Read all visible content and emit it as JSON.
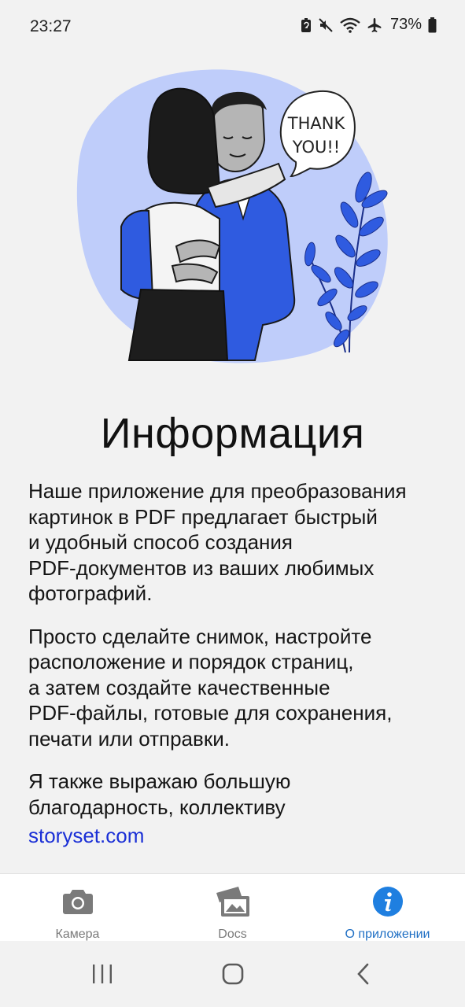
{
  "status_bar": {
    "time": "23:27",
    "battery": "73%",
    "icons": [
      "battery-saver-icon",
      "mute-icon",
      "wifi-icon",
      "airplane-icon",
      "battery-icon"
    ]
  },
  "illustration": {
    "speech_bubble_line1": "THANK",
    "speech_bubble_line2": "YOU!!",
    "blob_color": "#bfcdfa",
    "accent_color": "#2f5be0"
  },
  "page": {
    "title": "Информация",
    "paragraph1": "Наше приложение для преобразования\nкартинок в PDF предлагает быстрый\nи удобный способ создания\nPDF-документов из ваших любимых\nфотографий.",
    "paragraph2": "Просто сделайте снимок, настройте\nрасположение и порядок страниц,\nа затем создайте качественные\nPDF-файлы, готовые для сохранения,\nпечати или отправки.",
    "paragraph3": "Я также выражаю большую\nблагодарность, коллективу",
    "credit_link": "storyset.com"
  },
  "bottom_nav": {
    "items": [
      {
        "label": "Камера",
        "icon": "camera-icon",
        "active": false
      },
      {
        "label": "Docs",
        "icon": "images-icon",
        "active": false
      },
      {
        "label": "О приложении",
        "icon": "info-icon",
        "active": true
      }
    ],
    "active_color": "#1f6fc4",
    "inactive_color": "#7a7a7a"
  },
  "system_nav": {
    "buttons": [
      "recents-icon",
      "home-icon",
      "back-icon"
    ]
  }
}
